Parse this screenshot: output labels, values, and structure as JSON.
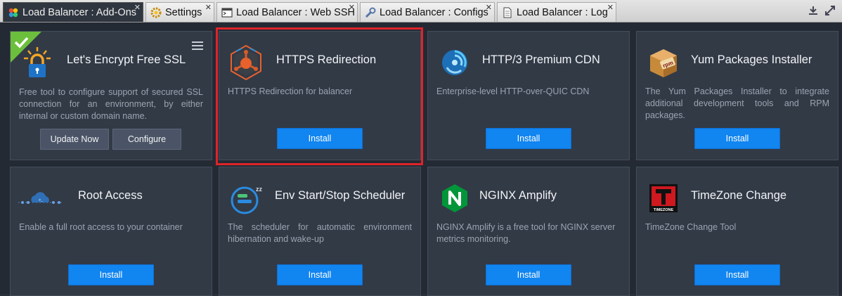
{
  "tabs": [
    {
      "label": "Load Balancer : Add-Ons",
      "active": true
    },
    {
      "label": "Settings"
    },
    {
      "label": "Load Balancer : Web SSH"
    },
    {
      "label": "Load Balancer : Configs"
    },
    {
      "label": "Load Balancer : Log"
    }
  ],
  "close_glyph": "✕",
  "cards": [
    {
      "title": "Let's Encrypt Free SSL",
      "desc": "Free tool to configure support of secured SSL connection for an environment, by either internal or custom domain name.",
      "btn1": "Update Now",
      "btn2": "Configure",
      "icon": "lock-icon",
      "installed": true
    },
    {
      "title": "HTTPS Redirection",
      "desc": "HTTPS Redirection for balancer",
      "btn": "Install",
      "icon": "https-redirect-icon"
    },
    {
      "title": "HTTP/3 Premium CDN",
      "desc": "Enterprise-level HTTP-over-QUIC CDN",
      "btn": "Install",
      "icon": "cdn-swirl-icon"
    },
    {
      "title": "Yum Packages Installer",
      "desc": "The Yum Packages Installer to integrate additional development tools and RPM packages.",
      "btn": "Install",
      "icon": "rpm-box-icon"
    },
    {
      "title": "Root Access",
      "desc": "Enable a full root access to your container",
      "btn": "Install",
      "icon": "cloud-network-icon"
    },
    {
      "title": "Env Start/Stop Scheduler",
      "desc": "The scheduler for automatic environment hibernation and wake-up",
      "btn": "Install",
      "icon": "scheduler-icon"
    },
    {
      "title": "NGINX Amplify",
      "desc": "NGINX Amplify is a free tool for NGINX server metrics monitoring.",
      "btn": "Install",
      "icon": "nginx-icon"
    },
    {
      "title": "TimeZone Change",
      "desc": "TimeZone Change Tool",
      "btn": "Install",
      "icon": "timezone-icon",
      "icon_text": "TIMEZONE"
    }
  ],
  "colors": {
    "accent": "#1185f0",
    "highlight": "#e0232a",
    "installed_badge": "#6cbf3c"
  }
}
